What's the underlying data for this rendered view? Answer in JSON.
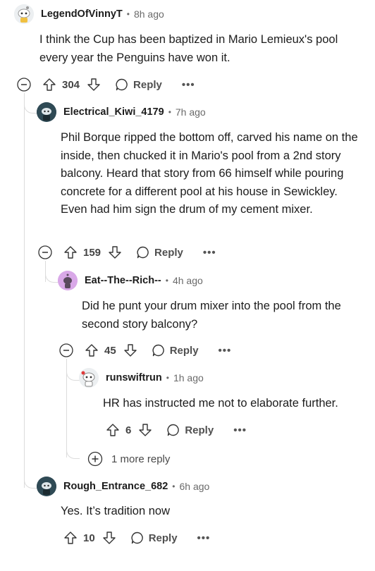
{
  "comments": [
    {
      "author": "LegendOfVinnyT",
      "time": "8h ago",
      "body": "I think the Cup has been baptized in Mario Lemieux's pool every year the Penguins have won it.",
      "votes": "304",
      "reply_label": "Reply",
      "more_label": "•••"
    },
    {
      "author": "Electrical_Kiwi_4179",
      "time": "7h ago",
      "body": "Phil Borque ripped the bottom off, carved his name on the inside, then chucked it in Mario's pool from a 2nd story balcony. Heard that story from 66 himself while pouring concrete for a different pool at his house in Sewickley. Even had him sign the drum of my cement mixer.",
      "votes": "159",
      "reply_label": "Reply",
      "more_label": "•••"
    },
    {
      "author": "Eat--The--Rich--",
      "time": "4h ago",
      "body": "Did he punt your drum mixer into the pool from the second story balcony?",
      "votes": "45",
      "reply_label": "Reply",
      "more_label": "•••"
    },
    {
      "author": "runswiftrun",
      "time": "1h ago",
      "body": "HR has instructed me not to elaborate further.",
      "votes": "6",
      "reply_label": "Reply",
      "more_label": "•••"
    },
    {
      "author": "Rough_Entrance_682",
      "time": "6h ago",
      "body": "Yes. It’s tradition now",
      "votes": "10",
      "reply_label": "Reply",
      "more_label": "•••"
    }
  ],
  "more_replies_label": "1 more reply",
  "colors": {
    "thread_line": "#dcdcdc",
    "meta_gray": "#6a6a6a",
    "avatar_purple": "#d9a8e8",
    "avatar_dark": "#2f4a55"
  }
}
